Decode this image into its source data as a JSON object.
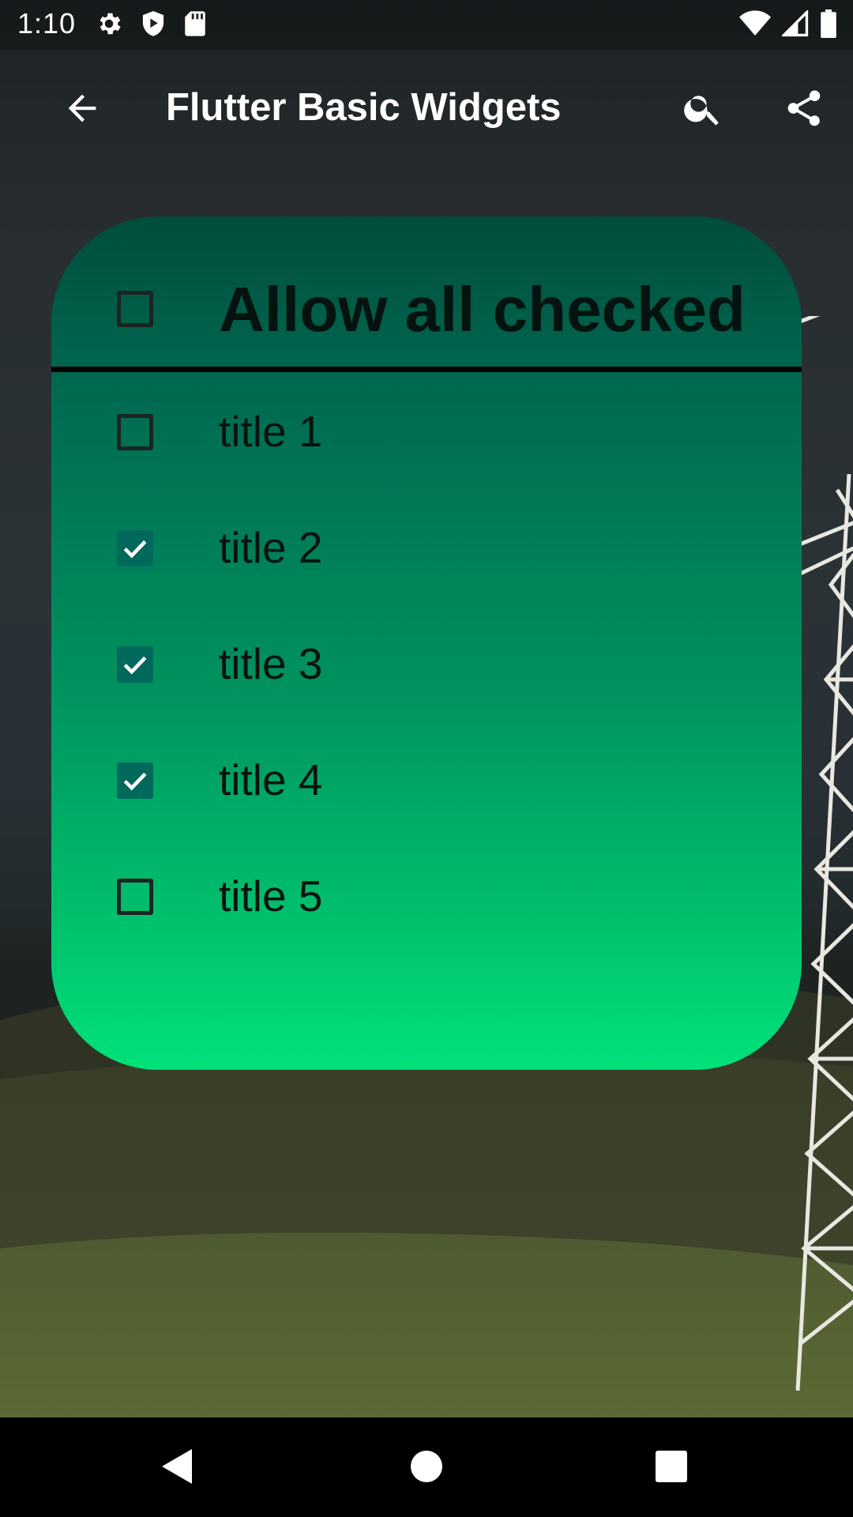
{
  "status_bar": {
    "time": "1:10",
    "left_icons": [
      "settings-icon",
      "play-protect-icon",
      "sd-card-icon"
    ],
    "right_icons": [
      "wifi-icon",
      "cell-signal-icon",
      "battery-icon"
    ]
  },
  "app_bar": {
    "title": "Flutter Basic Widgets",
    "back_icon": "arrow-back-icon",
    "actions": [
      "search-icon",
      "share-icon"
    ]
  },
  "card": {
    "header": {
      "label": "Allow all checked",
      "checked": false
    },
    "items": [
      {
        "label": "title 1",
        "checked": false
      },
      {
        "label": "title 2",
        "checked": true
      },
      {
        "label": "title 3",
        "checked": true
      },
      {
        "label": "title 4",
        "checked": true
      },
      {
        "label": "title 5",
        "checked": false
      }
    ]
  },
  "nav_bar": {
    "buttons": [
      "back-triangle-icon",
      "home-circle-icon",
      "recents-square-icon"
    ]
  },
  "colors": {
    "card_top": "#004d3c",
    "card_bottom": "#00e27a",
    "checkbox_checked": "#00695c",
    "status_bar_text": "#ffffff"
  }
}
